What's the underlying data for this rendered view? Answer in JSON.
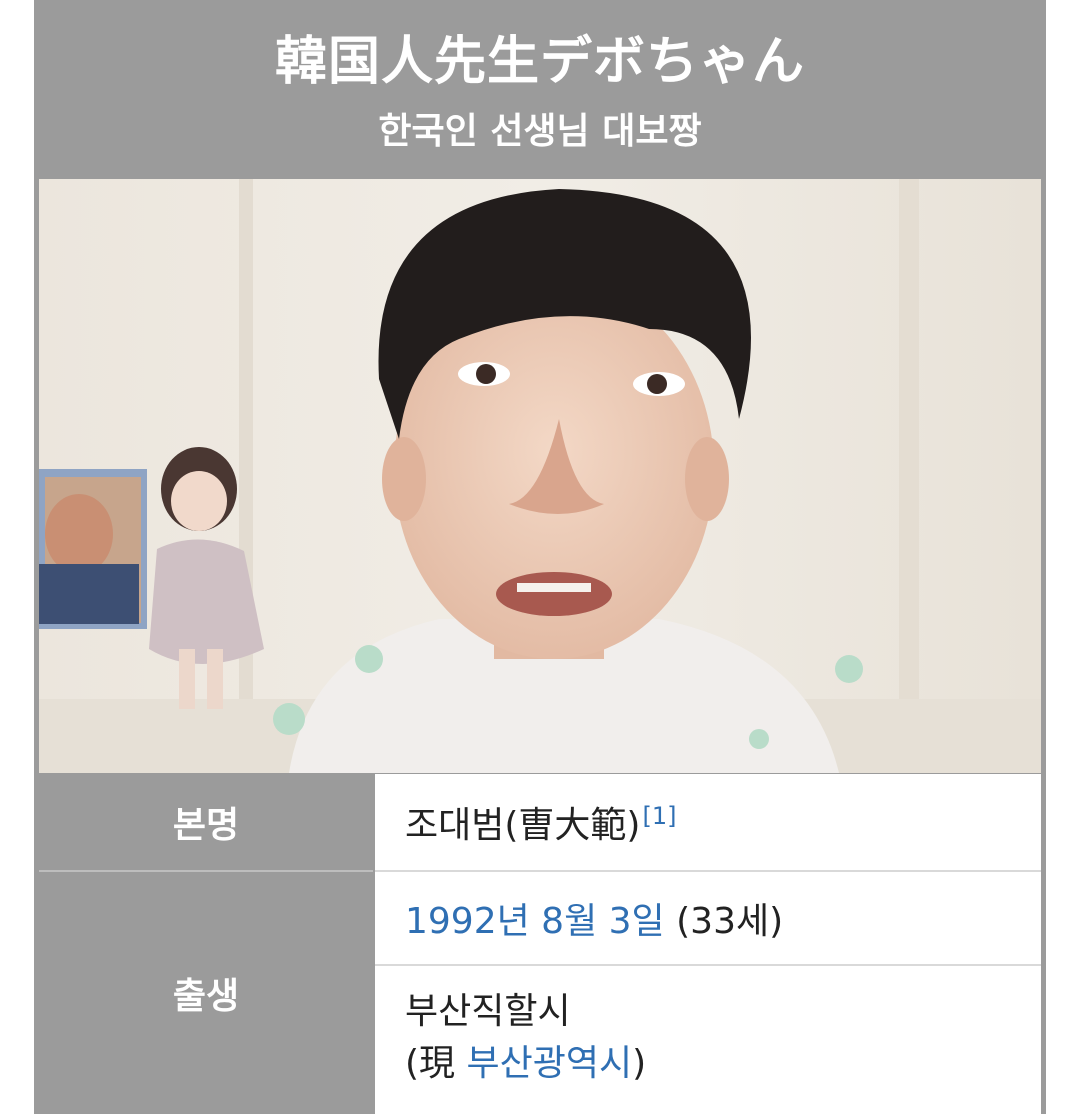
{
  "header": {
    "title": "韓国人先生デボちゃん",
    "subtitle": "한국인 선생님 대보짱"
  },
  "photo": {
    "icon": "person-portrait-photo"
  },
  "infobox": {
    "real_name": {
      "label": "본명",
      "value": "조대범(曺大範)",
      "ref": "[1]"
    },
    "birth": {
      "label": "출생",
      "date_link": "1992년 8월 3일",
      "age": "(33세)",
      "place_line1": "부산직할시",
      "place_prefix": "(現 ",
      "place_link": "부산광역시",
      "place_suffix": ")"
    }
  },
  "colors": {
    "header_bg": "#9b9b9b",
    "link": "#2f6fb3",
    "text": "#222222"
  }
}
